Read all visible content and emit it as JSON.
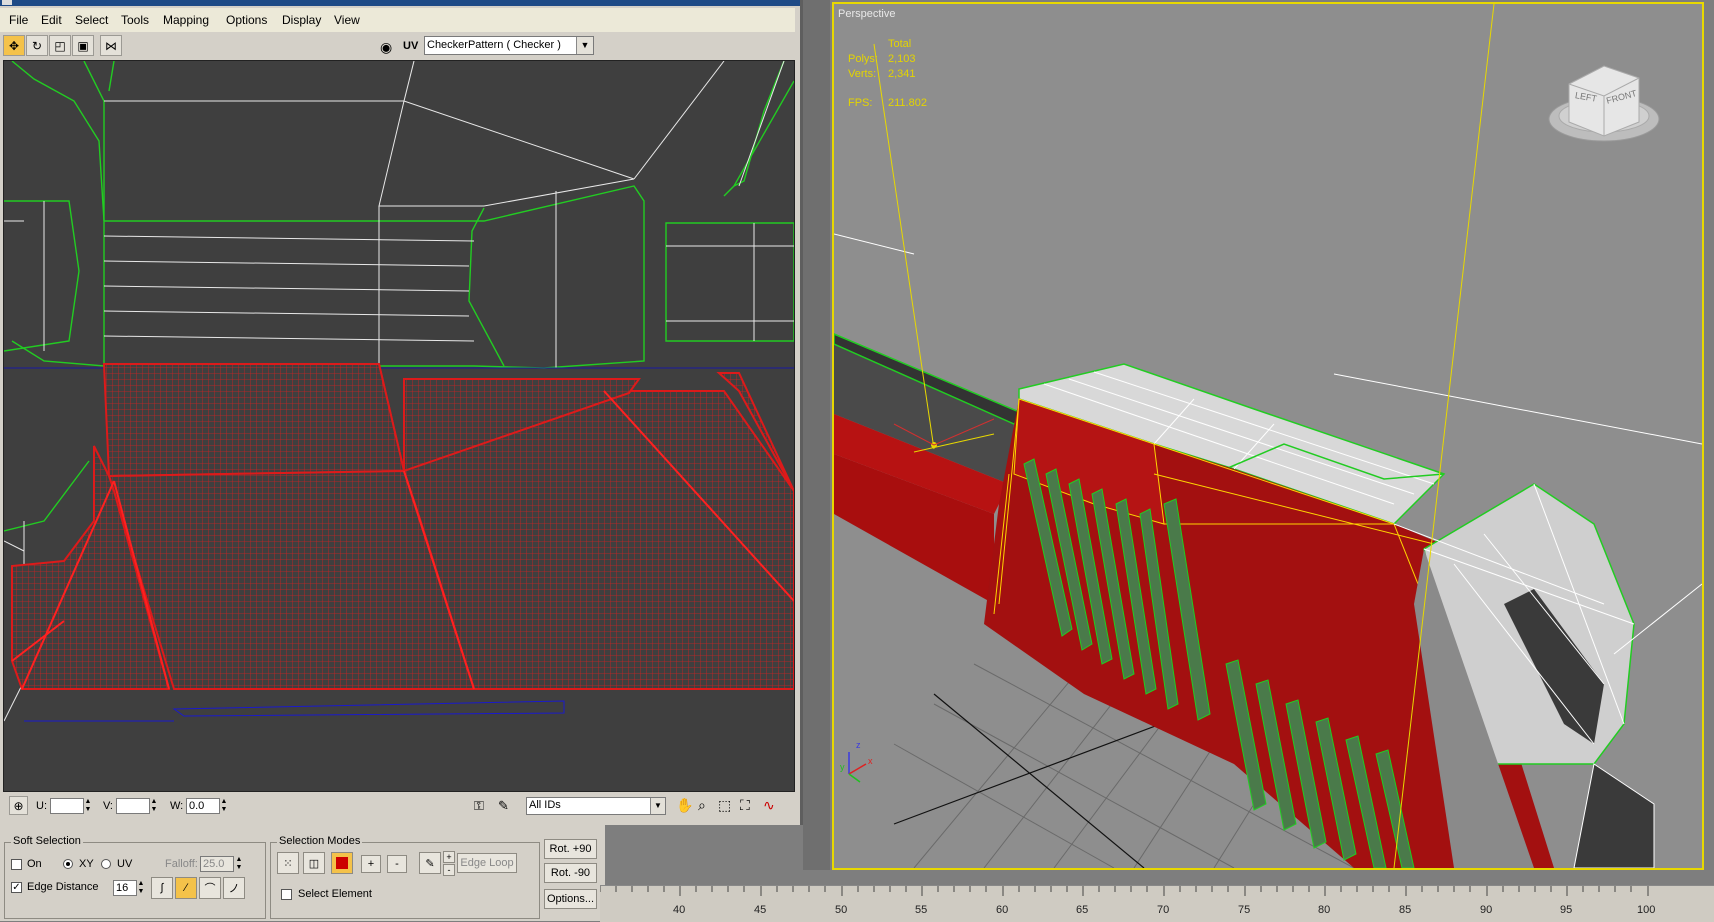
{
  "menu": [
    "File",
    "Edit",
    "Select",
    "Tools",
    "Mapping",
    "Options",
    "Display",
    "View"
  ],
  "toolbar": {
    "uv_label": "UV",
    "texture_select": "CheckerPattern  ( Checker )"
  },
  "status": {
    "u_label": "U:",
    "u_value": "",
    "v_label": "V:",
    "v_value": "",
    "w_label": "W:",
    "w_value": "0.0",
    "ids_select": "All IDs"
  },
  "soft_selection": {
    "title": "Soft Selection",
    "on_label": "On",
    "on_checked": false,
    "xy_label": "XY",
    "uv_label": "UV",
    "xy_selected": true,
    "falloff_label": "Falloff:",
    "falloff_value": "25.0",
    "edge_distance_label": "Edge Distance",
    "edge_distance_checked": true,
    "edge_distance_value": "16"
  },
  "selection_modes": {
    "title": "Selection Modes",
    "plus_label": "+",
    "minus_label": "-",
    "edge_loop_label": "Edge Loop",
    "select_element_label": "Select Element",
    "select_element_checked": false
  },
  "rotate": {
    "rot_plus": "Rot. +90",
    "rot_minus": "Rot. -90",
    "options": "Options..."
  },
  "viewport": {
    "label": "Perspective",
    "total_label": "Total",
    "polys_label": "Polys:",
    "polys_value": "2,103",
    "verts_label": "Verts:",
    "verts_value": "2,341",
    "fps_label": "FPS:",
    "fps_value": "211.802",
    "cube_left": "LEFT",
    "cube_front": "FRONT",
    "axis_x": "x",
    "axis_y": "y",
    "axis_z": "z"
  },
  "timeline": [
    "40",
    "45",
    "50",
    "55",
    "60",
    "65",
    "70",
    "75",
    "80",
    "85",
    "90",
    "95",
    "100"
  ],
  "colors": {
    "selection_red": "#cc0000",
    "uv_edge_green": "#22cc22",
    "viewport_border": "#e8d800",
    "uv_background": "#3f3f3f"
  }
}
